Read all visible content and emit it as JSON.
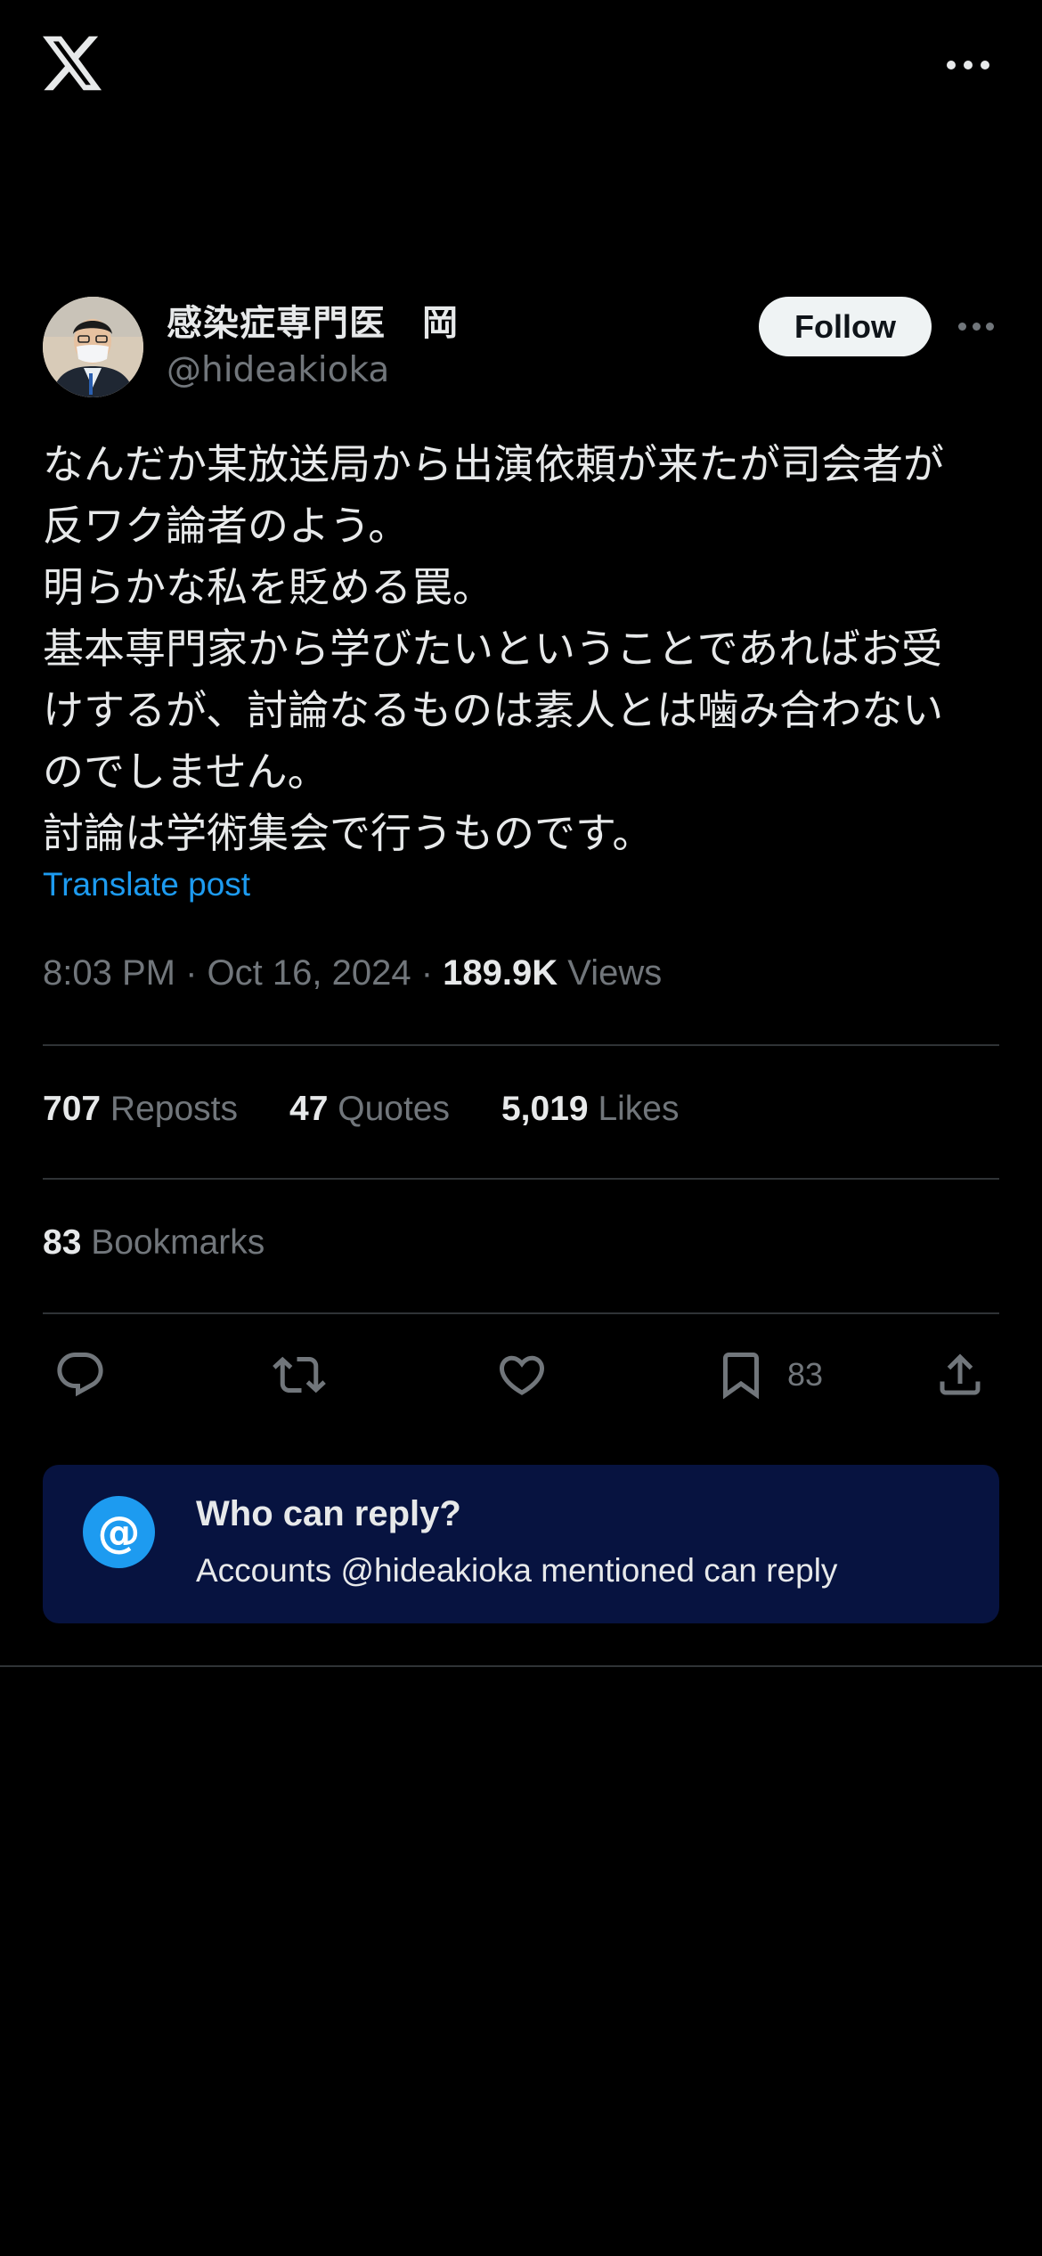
{
  "header": {
    "logo_icon": "x-logo-icon",
    "more_icon": "more-horizontal-icon"
  },
  "author": {
    "display_name": "感染症専門医　岡",
    "handle": "@hideakioka",
    "follow_label": "Follow"
  },
  "tweet": {
    "lines": [
      "なんだか某放送局から出演依頼が来たが司会者が",
      "反ワク論者のよう。",
      "明らかな私を貶める罠。",
      "基本専門家から学びたいということであればお受",
      "けするが、討論なるものは素人とは噛み合わない",
      "のでしません。",
      "討論は学術集会で行うものです。"
    ],
    "translate_label": "Translate post",
    "time": "8:03 PM",
    "separator": "·",
    "date": "Oct 16, 2024",
    "views_count": "189.9K",
    "views_label": "Views"
  },
  "stats": {
    "reposts": {
      "count": "707",
      "label": "Reposts"
    },
    "quotes": {
      "count": "47",
      "label": "Quotes"
    },
    "likes": {
      "count": "5,019",
      "label": "Likes"
    },
    "bookmarks": {
      "count": "83",
      "label": "Bookmarks"
    }
  },
  "actions": {
    "bookmark_count": "83"
  },
  "reply_restriction": {
    "icon_glyph": "@",
    "title": "Who can reply?",
    "subtitle": "Accounts @hideakioka mentioned can reply"
  },
  "colors": {
    "background": "#000000",
    "accent": "#1d9bf0",
    "secondary_text": "#71767b",
    "reply_box": "#071340"
  }
}
